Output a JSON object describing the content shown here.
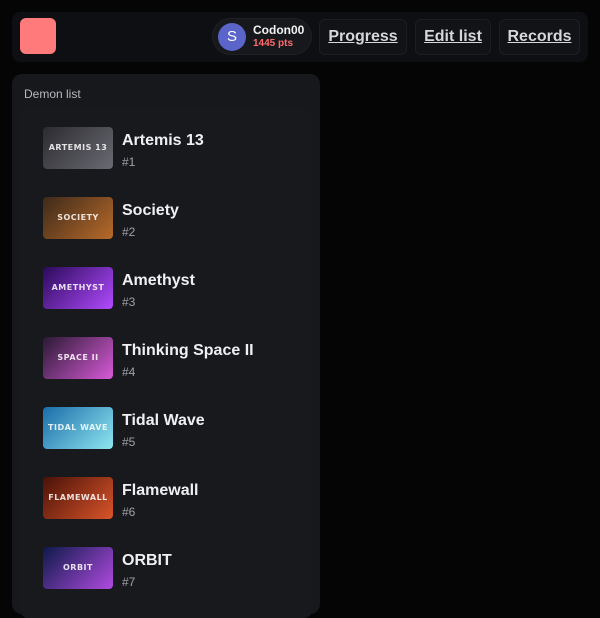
{
  "header": {
    "user": {
      "avatar_letter": "S",
      "name": "Codon00",
      "points": "1445 pts"
    },
    "nav": {
      "progress": "Progress",
      "edit_list": "Edit list",
      "records": "Records"
    },
    "colors": {
      "logo": "#ff7b7b",
      "points": "#ff6b6b",
      "avatar": "#5b65c9"
    }
  },
  "panel": {
    "title": "Demon list",
    "items": [
      {
        "name": "Artemis 13",
        "rank": "#1",
        "thumb_text": "ARTEMIS 13",
        "thumb_colors": [
          "#2b2b30",
          "#6a6a72"
        ]
      },
      {
        "name": "Society",
        "rank": "#2",
        "thumb_text": "SOCIETY",
        "thumb_colors": [
          "#3d2a1a",
          "#b86a2a"
        ]
      },
      {
        "name": "Amethyst",
        "rank": "#3",
        "thumb_text": "AMETHYST",
        "thumb_colors": [
          "#2a0a5a",
          "#b24bff"
        ]
      },
      {
        "name": "Thinking Space II",
        "rank": "#4",
        "thumb_text": "SPACE II",
        "thumb_colors": [
          "#2a1a33",
          "#d85ad8"
        ]
      },
      {
        "name": "Tidal Wave",
        "rank": "#5",
        "thumb_text": "TIDAL WAVE",
        "thumb_colors": [
          "#1a6da8",
          "#8fe6f0"
        ]
      },
      {
        "name": "Flamewall",
        "rank": "#6",
        "thumb_text": "FLAMEWALL",
        "thumb_colors": [
          "#4a1208",
          "#d9542a"
        ]
      },
      {
        "name": "ORBIT",
        "rank": "#7",
        "thumb_text": "ORBIT",
        "thumb_colors": [
          "#0d1a4a",
          "#b04be0"
        ]
      }
    ]
  }
}
